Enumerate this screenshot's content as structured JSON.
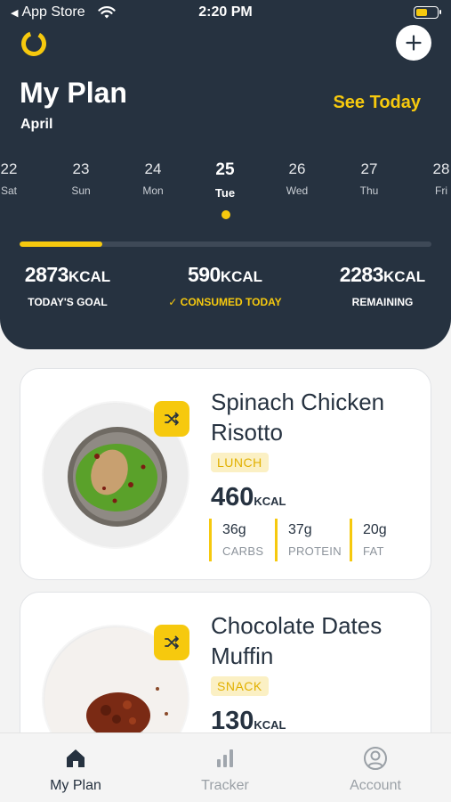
{
  "status_bar": {
    "back_label": "App Store",
    "time": "2:20 PM",
    "battery_level": 0.55
  },
  "header": {
    "title": "My Plan",
    "month": "April",
    "see_today": "See Today",
    "days": [
      {
        "num": "22",
        "name": "Sat"
      },
      {
        "num": "23",
        "name": "Sun"
      },
      {
        "num": "24",
        "name": "Mon"
      },
      {
        "num": "25",
        "name": "Tue",
        "active": true
      },
      {
        "num": "26",
        "name": "Wed"
      },
      {
        "num": "27",
        "name": "Thu"
      },
      {
        "num": "28",
        "name": "Fri"
      }
    ],
    "progress_fraction": 0.2,
    "stats": {
      "goal": {
        "value": "2873",
        "unit": "KCAL",
        "label": "TODAY'S GOAL"
      },
      "consumed": {
        "value": "590",
        "unit": "KCAL",
        "label": "CONSUMED TODAY"
      },
      "remaining": {
        "value": "2283",
        "unit": "KCAL",
        "label": "REMAINING"
      }
    }
  },
  "meals": [
    {
      "name": "Spinach Chicken Risotto",
      "tag": "LUNCH",
      "kcal": "460",
      "kcal_unit": "KCAL",
      "macros": [
        {
          "grams": "36g",
          "label": "CARBS"
        },
        {
          "grams": "37g",
          "label": "PROTEIN"
        },
        {
          "grams": "20g",
          "label": "FAT"
        }
      ]
    },
    {
      "name": "Chocolate Dates Muffin",
      "tag": "SNACK",
      "kcal": "130",
      "kcal_unit": "KCAL"
    }
  ],
  "tabs": [
    {
      "label": "My Plan",
      "icon": "home-icon",
      "active": true
    },
    {
      "label": "Tracker",
      "icon": "bar-chart-icon"
    },
    {
      "label": "Account",
      "icon": "user-circle-icon"
    }
  ],
  "colors": {
    "navy": "#263240",
    "accent": "#f6c90e"
  }
}
